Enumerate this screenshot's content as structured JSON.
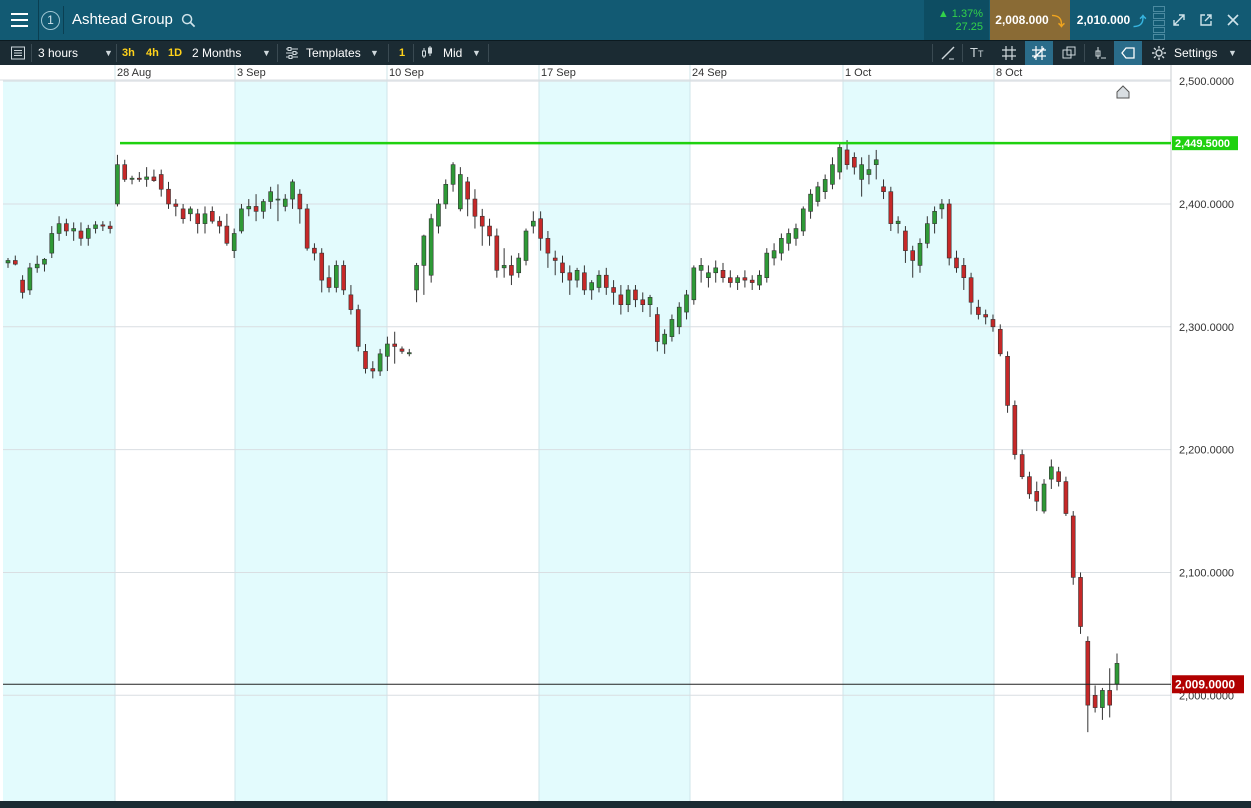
{
  "window": {
    "badge": "1",
    "title": "Ashtead Group",
    "change_pct": "▲ 1.37%",
    "change_abs": "27.25",
    "sell_price": "2,008.000",
    "buy_price": "2,010.000"
  },
  "icons": {
    "menu": "hamburger-menu-icon",
    "search": "search-icon",
    "sell_arrow": "arrow-down-icon",
    "buy_arrow": "arrow-up-icon",
    "expand": "expand-icon",
    "popout": "popout-icon",
    "close": "close-icon"
  },
  "toolbar": {
    "interval": "3 hours",
    "quick_3h": "3h",
    "quick_4h": "4h",
    "quick_1d": "1D",
    "range": "2 Months",
    "templates": "Templates",
    "count": "1",
    "price_type": "Mid",
    "settings": "Settings"
  },
  "colors": {
    "up": "#2e9a36",
    "down": "#c62828",
    "band": "#e3fbfd",
    "level_line": "#1fd10f",
    "current_line": "#222222",
    "current_label": "#b10000",
    "header": "#125a73",
    "toolbar": "#1b2b33"
  },
  "chart_data": {
    "type": "candlestick",
    "x_ticks": [
      "28 Aug",
      "3 Sep",
      "10 Sep",
      "17 Sep",
      "24 Sep",
      "1 Oct",
      "8 Oct"
    ],
    "y_ticks": [
      "2,500.0000",
      "2,400.0000",
      "2,300.0000",
      "2,200.0000",
      "2,100.0000",
      "2,000.0000"
    ],
    "y_tick_values": [
      2500,
      2400,
      2300,
      2200,
      2100,
      2000
    ],
    "ylim": [
      1905,
      2505
    ],
    "horizontal_level": {
      "value": 2449.5,
      "label": "2,449.5000"
    },
    "current_price": {
      "value": 2009.0,
      "label": "2,009.0000"
    },
    "candles": [
      [
        2352,
        2356,
        2348,
        2354
      ],
      [
        2354,
        2358,
        2350,
        2351
      ],
      [
        2338,
        2342,
        2323,
        2328
      ],
      [
        2330,
        2352,
        2326,
        2348
      ],
      [
        2348,
        2358,
        2344,
        2351
      ],
      [
        2351,
        2356,
        2345,
        2355
      ],
      [
        2360,
        2382,
        2356,
        2376
      ],
      [
        2376,
        2390,
        2370,
        2384
      ],
      [
        2384,
        2388,
        2374,
        2378
      ],
      [
        2378,
        2385,
        2370,
        2380
      ],
      [
        2378,
        2385,
        2366,
        2372
      ],
      [
        2372,
        2383,
        2366,
        2380
      ],
      [
        2380,
        2386,
        2376,
        2383
      ],
      [
        2383,
        2386,
        2378,
        2382
      ],
      [
        2382,
        2386,
        2376,
        2380
      ],
      [
        2400,
        2440,
        2398,
        2432
      ],
      [
        2432,
        2436,
        2418,
        2420
      ],
      [
        2420,
        2423,
        2416,
        2421
      ],
      [
        2421,
        2426,
        2418,
        2420
      ],
      [
        2420,
        2430,
        2414,
        2422
      ],
      [
        2422,
        2428,
        2418,
        2419
      ],
      [
        2424,
        2428,
        2406,
        2412
      ],
      [
        2412,
        2418,
        2396,
        2400
      ],
      [
        2400,
        2404,
        2390,
        2398
      ],
      [
        2396,
        2400,
        2384,
        2388
      ],
      [
        2392,
        2398,
        2386,
        2396
      ],
      [
        2392,
        2396,
        2376,
        2384
      ],
      [
        2384,
        2398,
        2376,
        2392
      ],
      [
        2394,
        2398,
        2384,
        2386
      ],
      [
        2386,
        2390,
        2376,
        2382
      ],
      [
        2382,
        2392,
        2366,
        2368
      ],
      [
        2362,
        2380,
        2356,
        2376
      ],
      [
        2378,
        2400,
        2376,
        2396
      ],
      [
        2396,
        2404,
        2390,
        2398
      ],
      [
        2398,
        2408,
        2386,
        2394
      ],
      [
        2394,
        2404,
        2388,
        2402
      ],
      [
        2402,
        2414,
        2396,
        2410
      ],
      [
        2404,
        2416,
        2386,
        2404
      ],
      [
        2398,
        2408,
        2394,
        2404
      ],
      [
        2404,
        2420,
        2396,
        2418
      ],
      [
        2408,
        2412,
        2384,
        2396
      ],
      [
        2396,
        2400,
        2362,
        2364
      ],
      [
        2364,
        2368,
        2354,
        2360
      ],
      [
        2360,
        2364,
        2328,
        2338
      ],
      [
        2340,
        2350,
        2328,
        2332
      ],
      [
        2332,
        2354,
        2328,
        2350
      ],
      [
        2350,
        2354,
        2326,
        2330
      ],
      [
        2326,
        2334,
        2310,
        2314
      ],
      [
        2314,
        2318,
        2280,
        2284
      ],
      [
        2280,
        2286,
        2262,
        2266
      ],
      [
        2266,
        2272,
        2258,
        2264
      ],
      [
        2264,
        2282,
        2260,
        2278
      ],
      [
        2276,
        2292,
        2264,
        2286
      ],
      [
        2286,
        2296,
        2270,
        2284
      ],
      [
        2282,
        2284,
        2278,
        2280
      ],
      [
        2278,
        2282,
        2276,
        2279
      ],
      [
        2330,
        2352,
        2320,
        2350
      ],
      [
        2350,
        2375,
        2326,
        2374
      ],
      [
        2342,
        2392,
        2336,
        2388
      ],
      [
        2382,
        2404,
        2376,
        2400
      ],
      [
        2400,
        2420,
        2396,
        2416
      ],
      [
        2416,
        2434,
        2410,
        2432
      ],
      [
        2396,
        2430,
        2394,
        2424
      ],
      [
        2418,
        2422,
        2390,
        2404
      ],
      [
        2404,
        2412,
        2380,
        2390
      ],
      [
        2390,
        2396,
        2366,
        2382
      ],
      [
        2382,
        2388,
        2366,
        2374
      ],
      [
        2374,
        2380,
        2340,
        2346
      ],
      [
        2348,
        2364,
        2340,
        2350
      ],
      [
        2350,
        2358,
        2334,
        2342
      ],
      [
        2344,
        2360,
        2340,
        2356
      ],
      [
        2354,
        2380,
        2350,
        2378
      ],
      [
        2382,
        2394,
        2376,
        2386
      ],
      [
        2388,
        2394,
        2362,
        2372
      ],
      [
        2372,
        2378,
        2348,
        2360
      ],
      [
        2356,
        2362,
        2342,
        2354
      ],
      [
        2352,
        2358,
        2336,
        2344
      ],
      [
        2344,
        2350,
        2326,
        2338
      ],
      [
        2338,
        2348,
        2332,
        2346
      ],
      [
        2344,
        2350,
        2326,
        2330
      ],
      [
        2330,
        2338,
        2322,
        2336
      ],
      [
        2332,
        2346,
        2328,
        2342
      ],
      [
        2342,
        2348,
        2326,
        2332
      ],
      [
        2332,
        2338,
        2318,
        2328
      ],
      [
        2326,
        2334,
        2310,
        2318
      ],
      [
        2318,
        2334,
        2312,
        2330
      ],
      [
        2330,
        2334,
        2316,
        2322
      ],
      [
        2322,
        2328,
        2312,
        2318
      ],
      [
        2318,
        2326,
        2308,
        2324
      ],
      [
        2310,
        2316,
        2280,
        2288
      ],
      [
        2286,
        2298,
        2278,
        2294
      ],
      [
        2292,
        2310,
        2288,
        2306
      ],
      [
        2300,
        2320,
        2294,
        2316
      ],
      [
        2312,
        2330,
        2306,
        2326
      ],
      [
        2322,
        2350,
        2318,
        2348
      ],
      [
        2346,
        2356,
        2336,
        2350
      ],
      [
        2340,
        2350,
        2332,
        2344
      ],
      [
        2344,
        2354,
        2336,
        2348
      ],
      [
        2346,
        2352,
        2336,
        2340
      ],
      [
        2340,
        2346,
        2332,
        2336
      ],
      [
        2336,
        2342,
        2330,
        2340
      ],
      [
        2340,
        2346,
        2332,
        2338
      ],
      [
        2338,
        2342,
        2330,
        2336
      ],
      [
        2334,
        2346,
        2330,
        2342
      ],
      [
        2340,
        2364,
        2336,
        2360
      ],
      [
        2356,
        2368,
        2350,
        2362
      ],
      [
        2360,
        2376,
        2354,
        2372
      ],
      [
        2368,
        2380,
        2362,
        2376
      ],
      [
        2372,
        2384,
        2366,
        2380
      ],
      [
        2378,
        2398,
        2374,
        2396
      ],
      [
        2394,
        2412,
        2388,
        2408
      ],
      [
        2402,
        2418,
        2398,
        2414
      ],
      [
        2410,
        2424,
        2404,
        2420
      ],
      [
        2416,
        2438,
        2412,
        2432
      ],
      [
        2426,
        2450,
        2420,
        2446
      ],
      [
        2444,
        2452,
        2428,
        2432
      ],
      [
        2438,
        2442,
        2424,
        2430
      ],
      [
        2420,
        2438,
        2406,
        2432
      ],
      [
        2424,
        2440,
        2416,
        2428
      ],
      [
        2432,
        2444,
        2420,
        2436
      ],
      [
        2414,
        2420,
        2404,
        2410
      ],
      [
        2410,
        2414,
        2378,
        2384
      ],
      [
        2384,
        2390,
        2376,
        2386
      ],
      [
        2378,
        2382,
        2352,
        2362
      ],
      [
        2362,
        2366,
        2340,
        2354
      ],
      [
        2350,
        2372,
        2344,
        2368
      ],
      [
        2368,
        2390,
        2364,
        2384
      ],
      [
        2384,
        2398,
        2376,
        2394
      ],
      [
        2396,
        2404,
        2388,
        2400
      ],
      [
        2400,
        2404,
        2350,
        2356
      ],
      [
        2356,
        2362,
        2344,
        2348
      ],
      [
        2350,
        2356,
        2330,
        2340
      ],
      [
        2340,
        2344,
        2310,
        2320
      ],
      [
        2316,
        2322,
        2306,
        2310
      ],
      [
        2310,
        2314,
        2302,
        2308
      ],
      [
        2306,
        2310,
        2296,
        2300
      ],
      [
        2298,
        2302,
        2276,
        2278
      ],
      [
        2276,
        2280,
        2230,
        2236
      ],
      [
        2236,
        2240,
        2192,
        2196
      ],
      [
        2196,
        2200,
        2176,
        2178
      ],
      [
        2178,
        2182,
        2160,
        2164
      ],
      [
        2166,
        2174,
        2150,
        2158
      ],
      [
        2150,
        2176,
        2148,
        2172
      ],
      [
        2176,
        2192,
        2168,
        2186
      ],
      [
        2182,
        2186,
        2170,
        2174
      ],
      [
        2174,
        2178,
        2146,
        2148
      ],
      [
        2146,
        2150,
        2090,
        2096
      ],
      [
        2096,
        2100,
        2050,
        2056
      ],
      [
        2044,
        2048,
        1970,
        1992
      ],
      [
        2000,
        2008,
        1986,
        1990
      ],
      [
        1990,
        2006,
        1980,
        2004
      ],
      [
        2004,
        2022,
        1982,
        1992
      ],
      [
        2009,
        2034,
        2004,
        2026
      ]
    ]
  }
}
